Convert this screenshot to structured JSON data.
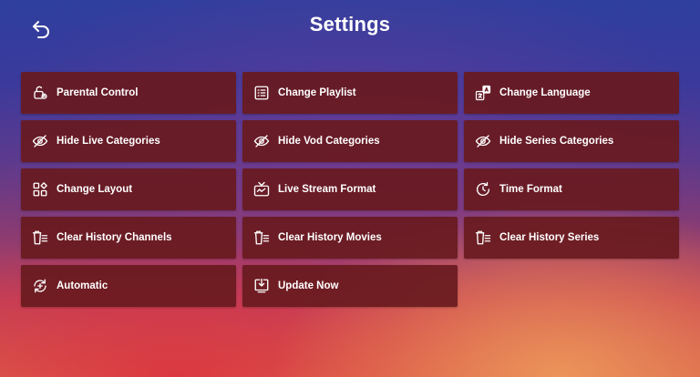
{
  "header": {
    "title": "Settings"
  },
  "tiles": [
    {
      "label": "Parental Control",
      "icon": "lock-settings-icon"
    },
    {
      "label": "Change Playlist",
      "icon": "playlist-icon"
    },
    {
      "label": "Change Language",
      "icon": "language-icon"
    },
    {
      "label": "Hide Live Categories",
      "icon": "eye-off-icon"
    },
    {
      "label": "Hide Vod Categories",
      "icon": "eye-off-icon"
    },
    {
      "label": "Hide Series Categories",
      "icon": "eye-off-icon"
    },
    {
      "label": "Change Layout",
      "icon": "layout-icon"
    },
    {
      "label": "Live Stream Format",
      "icon": "tv-icon"
    },
    {
      "label": "Time Format",
      "icon": "clock-icon"
    },
    {
      "label": "Clear History Channels",
      "icon": "clear-list-icon"
    },
    {
      "label": "Clear History Movies",
      "icon": "clear-list-icon"
    },
    {
      "label": "Clear History Series",
      "icon": "clear-list-icon"
    },
    {
      "label": "Automatic",
      "icon": "auto-refresh-icon"
    },
    {
      "label": "Update Now",
      "icon": "download-icon"
    }
  ],
  "colors": {
    "tile": "#681a1e",
    "text": "#ffffff"
  }
}
